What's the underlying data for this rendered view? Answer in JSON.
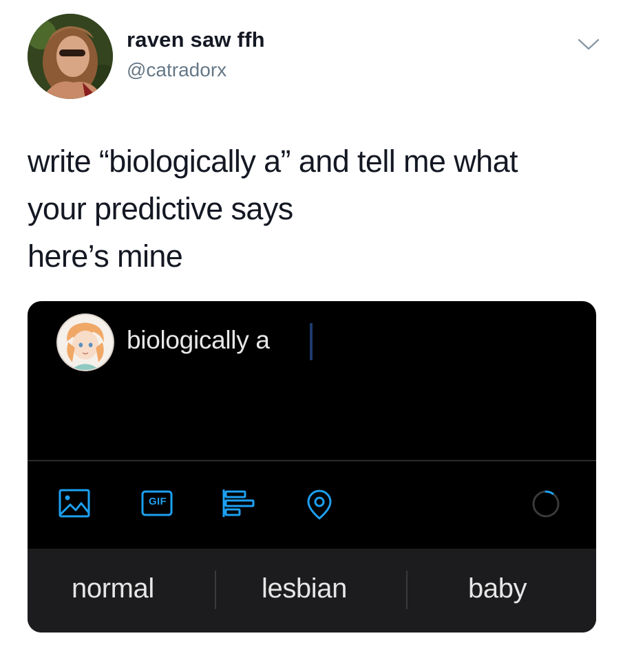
{
  "tweet": {
    "author": {
      "display_name": "raven saw ffh",
      "handle": "@catradorx"
    },
    "text_lines": [
      "write “biologically a” and tell me what",
      "your predictive says",
      "here’s mine"
    ]
  },
  "screenshot": {
    "compose_text": "biologically a",
    "toolbar": {
      "icons": [
        "image-icon",
        "gif-icon",
        "poll-icon",
        "location-icon"
      ],
      "gif_label": "GIF",
      "accent_color": "#1da1f2"
    },
    "suggestions": [
      "normal",
      "lesbian",
      "baby"
    ]
  },
  "colors": {
    "text_primary": "#141823",
    "text_secondary": "#657786",
    "dark_bg": "#000000",
    "suggestion_bg": "#1c1c1e"
  }
}
